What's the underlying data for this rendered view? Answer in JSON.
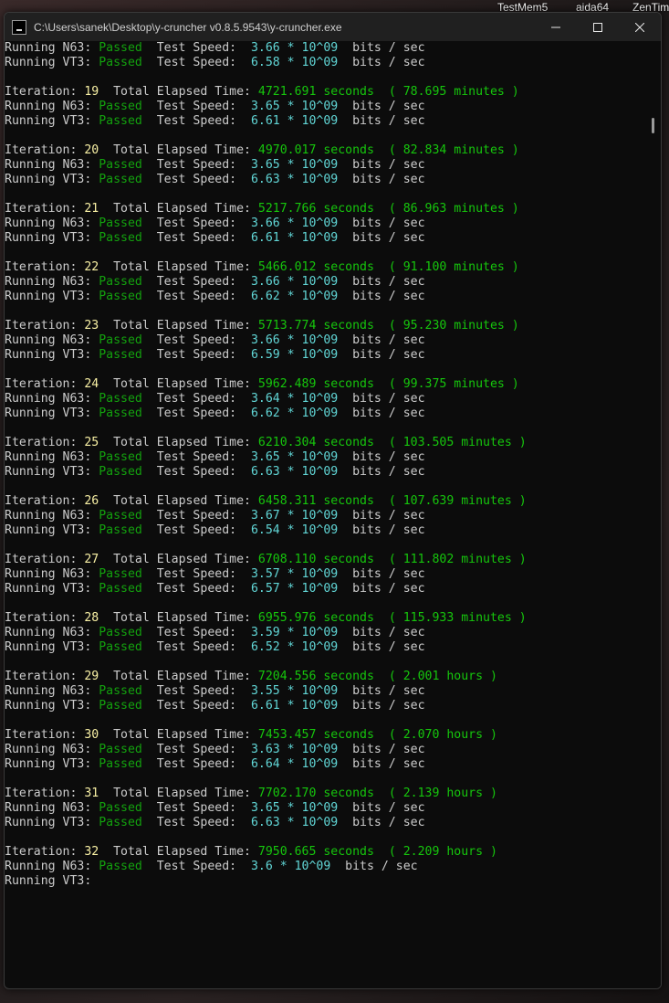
{
  "desktop": {
    "labels": [
      "TestMem5",
      "aida64",
      "ZenTim"
    ]
  },
  "window": {
    "title": "C:\\Users\\sanek\\Desktop\\y-cruncher v0.8.5.9543\\y-cruncher.exe",
    "minimize_icon": "minimize-icon",
    "maximize_icon": "maximize-icon",
    "close_icon": "close-icon"
  },
  "labels": {
    "iteration": "Iteration: ",
    "total_elapsed": "  Total Elapsed Time: ",
    "running_n63": "Running N63: ",
    "running_vt3": "Running VT3: ",
    "passed": "Passed",
    "test_speed": "  Test Speed:  ",
    "bits_sec": "  bits / sec"
  },
  "top_lines": [
    {
      "test": "N63",
      "speed": "3.66 * 10^09"
    },
    {
      "test": "VT3",
      "speed": "6.58 * 10^09"
    }
  ],
  "iterations": [
    {
      "n": "19",
      "seconds": "4721.691 seconds",
      "alt": "( 78.695 minutes )",
      "n63": "3.65 * 10^09",
      "vt3": "6.61 * 10^09"
    },
    {
      "n": "20",
      "seconds": "4970.017 seconds",
      "alt": "( 82.834 minutes )",
      "n63": "3.65 * 10^09",
      "vt3": "6.63 * 10^09"
    },
    {
      "n": "21",
      "seconds": "5217.766 seconds",
      "alt": "( 86.963 minutes )",
      "n63": "3.66 * 10^09",
      "vt3": "6.61 * 10^09"
    },
    {
      "n": "22",
      "seconds": "5466.012 seconds",
      "alt": "( 91.100 minutes )",
      "n63": "3.66 * 10^09",
      "vt3": "6.62 * 10^09"
    },
    {
      "n": "23",
      "seconds": "5713.774 seconds",
      "alt": "( 95.230 minutes )",
      "n63": "3.66 * 10^09",
      "vt3": "6.59 * 10^09"
    },
    {
      "n": "24",
      "seconds": "5962.489 seconds",
      "alt": "( 99.375 minutes )",
      "n63": "3.64 * 10^09",
      "vt3": "6.62 * 10^09"
    },
    {
      "n": "25",
      "seconds": "6210.304 seconds",
      "alt": "( 103.505 minutes )",
      "n63": "3.65 * 10^09",
      "vt3": "6.63 * 10^09"
    },
    {
      "n": "26",
      "seconds": "6458.311 seconds",
      "alt": "( 107.639 minutes )",
      "n63": "3.67 * 10^09",
      "vt3": "6.54 * 10^09"
    },
    {
      "n": "27",
      "seconds": "6708.110 seconds",
      "alt": "( 111.802 minutes )",
      "n63": "3.57 * 10^09",
      "vt3": "6.57 * 10^09"
    },
    {
      "n": "28",
      "seconds": "6955.976 seconds",
      "alt": "( 115.933 minutes )",
      "n63": "3.59 * 10^09",
      "vt3": "6.52 * 10^09"
    },
    {
      "n": "29",
      "seconds": "7204.556 seconds",
      "alt": "( 2.001 hours )",
      "n63": "3.55 * 10^09",
      "vt3": "6.61 * 10^09"
    },
    {
      "n": "30",
      "seconds": "7453.457 seconds",
      "alt": "( 2.070 hours )",
      "n63": "3.63 * 10^09",
      "vt3": "6.64 * 10^09"
    },
    {
      "n": "31",
      "seconds": "7702.170 seconds",
      "alt": "( 2.139 hours )",
      "n63": "3.65 * 10^09",
      "vt3": "6.63 * 10^09"
    },
    {
      "n": "32",
      "seconds": "7950.665 seconds",
      "alt": "( 2.209 hours )",
      "n63": "3.6 * 10^09",
      "vt3": null
    }
  ],
  "colors": {
    "passed": "#13a10e",
    "elapsed": "#16c60c",
    "speed": "#61d6d6",
    "iteration_number": "#f9f1a5",
    "text": "#cccccc",
    "console_bg": "#0c0c0c",
    "titlebar_bg": "#202020"
  }
}
